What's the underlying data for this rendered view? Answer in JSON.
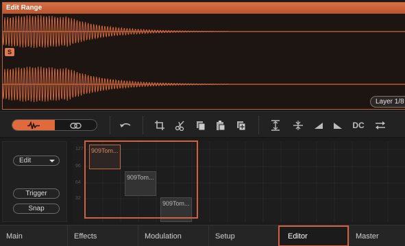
{
  "wave_editor": {
    "title": "Edit Range",
    "sample_marker": "S",
    "layer_badge": "Layer 1/8"
  },
  "toolbar": {
    "view_toggle": [
      {
        "name": "waveform-view",
        "icon": "waveform-icon",
        "active": true
      },
      {
        "name": "link-view",
        "icon": "link-icon",
        "active": false
      }
    ],
    "tools": [
      "undo-icon",
      "crop-icon",
      "scissors-icon",
      "copy-icon",
      "paste-icon",
      "duplicate-icon",
      "normalize-icon",
      "center-icon",
      "fade-in-icon",
      "fade-out-icon",
      "dc-offset",
      "reverse-icon"
    ],
    "dc_label": "DC"
  },
  "controls": {
    "mode_dropdown": "Edit",
    "trigger_label": "Trigger",
    "snap_label": "Snap"
  },
  "grid": {
    "velocity_labels": [
      "127",
      "96",
      "64",
      "32"
    ],
    "zones": [
      {
        "label": "909Tom...",
        "selected": true
      },
      {
        "label": "909Tom...",
        "selected": false
      },
      {
        "label": "909Tom...",
        "selected": false
      }
    ]
  },
  "tabs": [
    {
      "label": "Main",
      "active": false
    },
    {
      "label": "Effects",
      "active": false
    },
    {
      "label": "Modulation",
      "active": false
    },
    {
      "label": "Setup",
      "active": false
    },
    {
      "label": "Editor",
      "active": true
    },
    {
      "label": "Master",
      "active": false
    }
  ],
  "colors": {
    "accent": "#e06a3c",
    "waveform": "#d2683c",
    "background": "#1a1a1a"
  }
}
